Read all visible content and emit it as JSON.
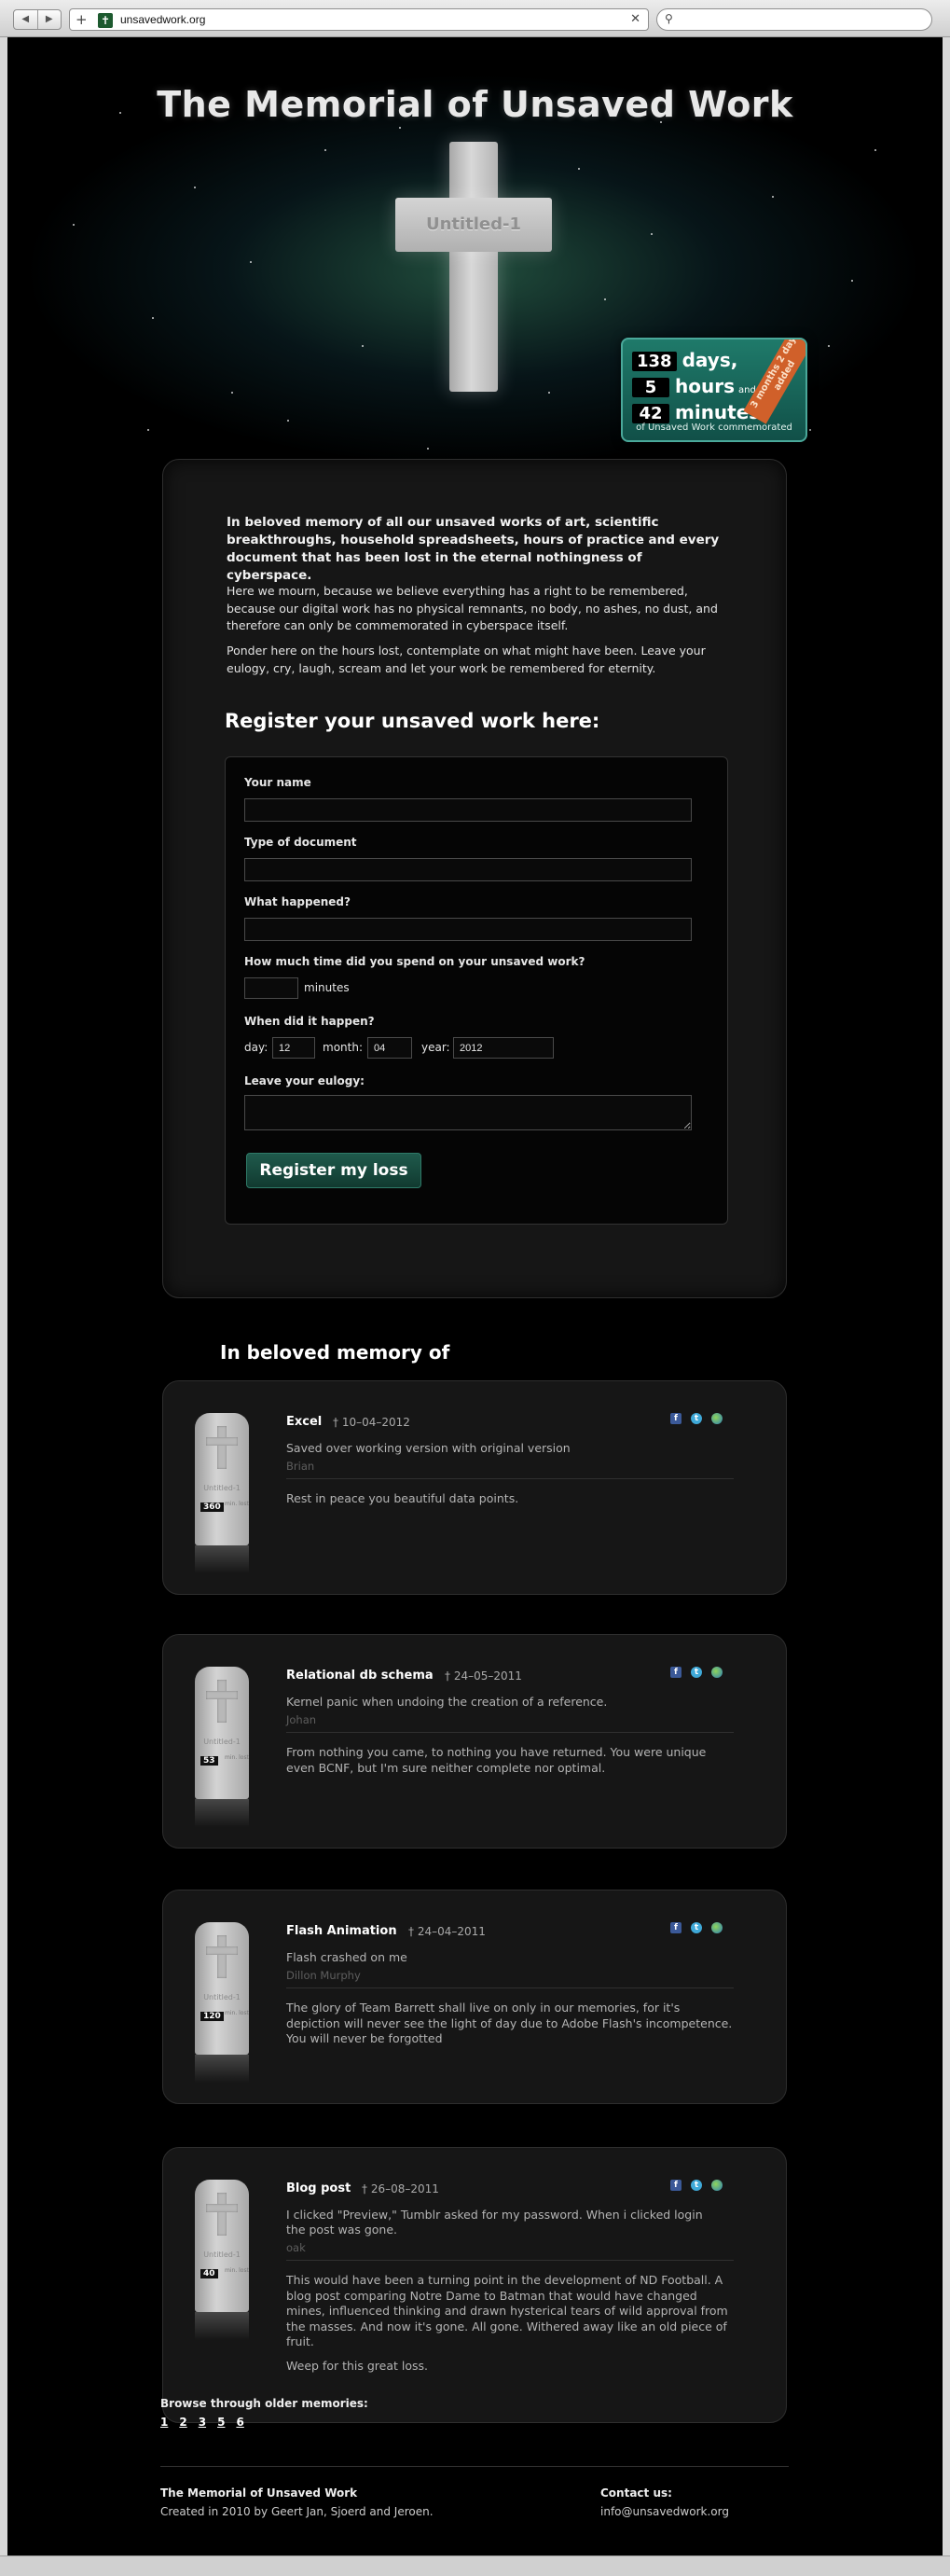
{
  "browser": {
    "url": "unsavedwork.org",
    "back_icon": "◀",
    "forward_icon": "▶",
    "add_icon": "+",
    "close_icon": "✕",
    "search_icon": "⚲"
  },
  "header": {
    "title": "The Memorial of Unsaved Work",
    "cross_label": "Untitled-1"
  },
  "counter": {
    "days": "138",
    "days_label": "days,",
    "hours": "5",
    "hours_label": "hours",
    "and_label": "and",
    "minutes": "42",
    "minutes_label": "minutes",
    "footer": "of Unsaved Work commemorated",
    "ribbon": "3 months 2 days added"
  },
  "intro": {
    "lead": "In beloved memory of all our unsaved works of art, scientific breakthroughs, household spreadsheets, hours of practice and every document that has been lost in the eternal nothingness of cyberspace.",
    "p1": "Here we mourn, because we believe everything has a right to be remembered, because our digital work has no physical remnants, no body, no ashes, no dust, and therefore can only be commemorated in cyberspace itself.",
    "p2": "Ponder here on the hours lost, contemplate on what might have been. Leave your eulogy, cry, laugh, scream and let your work be remembered for eternity."
  },
  "form": {
    "heading": "Register your unsaved work here:",
    "name_label": "Your name",
    "type_label": "Type of document",
    "what_label": "What happened?",
    "time_label": "How much time did you spend on your unsaved work?",
    "minutes_label": "minutes",
    "when_label": "When did it happen?",
    "day_label": "day:",
    "day_value": "12",
    "month_label": "month:",
    "month_value": "04",
    "year_label": "year:",
    "year_value": "2012",
    "eulogy_label": "Leave your eulogy:",
    "submit_label": "Register my loss"
  },
  "memories_heading": "In beloved memory of",
  "memorials": [
    {
      "title": "Excel",
      "date": "† 10–04–2012",
      "description": "Saved over working version with original version",
      "author": "Brian",
      "eulogy": "Rest in peace you beautiful data points.",
      "stone_name": "Untitled-1",
      "minutes": "360",
      "minutes_label": "min. lost"
    },
    {
      "title": "Relational db schema",
      "date": "† 24–05–2011",
      "description": "Kernel panic when undoing the creation of a reference.",
      "author": "Johan",
      "eulogy": "From nothing you came, to nothing you have returned. You were unique even BCNF, but I'm sure neither complete nor optimal.",
      "stone_name": "Untitled-1",
      "minutes": "53",
      "minutes_label": "min. lost"
    },
    {
      "title": "Flash Animation",
      "date": "† 24–04–2011",
      "description": "Flash crashed on me",
      "author": "Dillon Murphy",
      "eulogy": "The glory of Team Barrett shall live on only in our memories, for it's depiction will never see the light of day due to Adobe Flash's incompetence. You will never be forgotted",
      "stone_name": "Untitled-1",
      "minutes": "120",
      "minutes_label": "min. lost"
    },
    {
      "title": "Blog post",
      "date": "† 26–08–2011",
      "description": "I clicked \"Preview,\" Tumblr asked for my password. When i clicked login the post was gone.",
      "author": "oak",
      "eulogy": "This would have been a turning point in the development of ND Football. A blog post comparing Notre Dame to Batman that would have changed mines, influenced thinking and drawn hysterical tears of wild approval from the masses. And now it's gone. All gone. Withered away like an old piece of fruit.",
      "eulogy2": "Weep for this great loss.",
      "stone_name": "Untitled-1",
      "minutes": "40",
      "minutes_label": "min. lost"
    }
  ],
  "share_icons": {
    "facebook": "f",
    "twitter": "t",
    "web": ""
  },
  "browse": {
    "label": "Browse through older memories:",
    "pages": [
      "1",
      "2",
      "3",
      "5",
      "6"
    ]
  },
  "footer": {
    "name": "The Memorial of Unsaved Work",
    "credit": "Created in 2010 by Geert Jan, Sjoerd and Jeroen.",
    "contact_label": "Contact us:",
    "contact_email": "info@unsavedwork.org"
  }
}
